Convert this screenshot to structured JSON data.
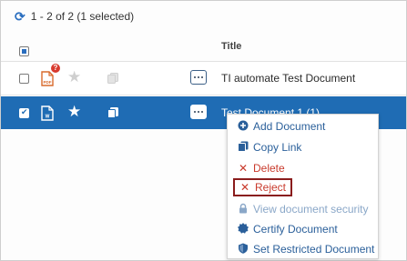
{
  "toolbar": {
    "refresh_icon": "refresh-icon",
    "count_text": "1 - 2 of 2 (1 selected)"
  },
  "table": {
    "column_title": "Title",
    "rows": [
      {
        "title": "TI automate Test Document",
        "type_icon": "pdf-file-icon",
        "badge": "?",
        "selected": false,
        "starred": false
      },
      {
        "title": "Test Document 1 (1)",
        "type_icon": "word-file-icon",
        "selected": true,
        "starred": true
      }
    ]
  },
  "context_menu": {
    "items": [
      {
        "label": "Add Document",
        "icon": "plus-circle-icon"
      },
      {
        "label": "Copy Link",
        "icon": "copy-icon"
      },
      {
        "label": "Delete",
        "icon": "x-icon"
      },
      {
        "label": "Reject",
        "icon": "x-icon"
      },
      {
        "label": "View document security",
        "icon": "lock-icon"
      },
      {
        "label": "Certify Document",
        "icon": "certificate-icon"
      },
      {
        "label": "Set Restricted Document",
        "icon": "shield-icon"
      }
    ]
  },
  "colors": {
    "selection": "#1f6cb4",
    "accent": "#2a6ebf",
    "danger": "#c93a2c",
    "highlight_border": "#8a1c1c"
  }
}
